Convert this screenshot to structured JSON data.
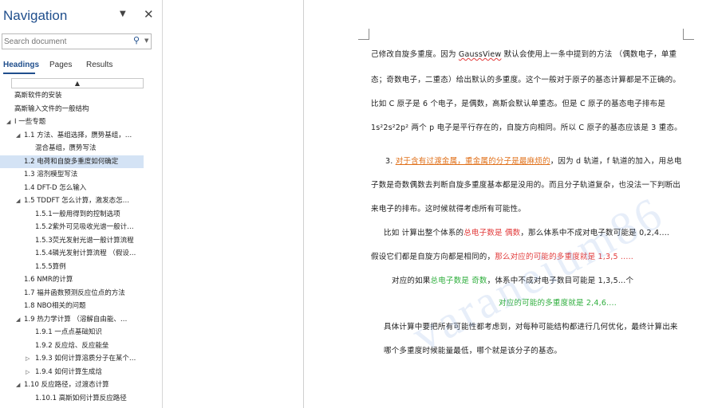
{
  "nav": {
    "title": "Navigation",
    "dropdown_icon": "▼",
    "close_icon": "✕",
    "search_placeholder": "Search document",
    "search_icon": "⚲",
    "search_caret": "▼",
    "tabs": [
      {
        "label": "Headings",
        "active": true
      },
      {
        "label": "Pages",
        "active": false
      },
      {
        "label": "Results",
        "active": false
      }
    ],
    "collapse_glyph": "▲",
    "tree": [
      {
        "label": "高斯软件的安装",
        "level": 0,
        "toggle": ""
      },
      {
        "label": "高斯输入文件的一般结构",
        "level": 0,
        "toggle": ""
      },
      {
        "label": "I 一些专题",
        "level": 0,
        "toggle": "◢"
      },
      {
        "label": "1.1 方法、基组选择，赝势基组，…",
        "level": 1,
        "toggle": "◢"
      },
      {
        "label": "混合基组，赝势写法",
        "level": 2,
        "toggle": ""
      },
      {
        "label": "1.2 电荷和自旋多重度如何确定",
        "level": 1,
        "toggle": "",
        "selected": true
      },
      {
        "label": "1.3 溶剂模型写法",
        "level": 1,
        "toggle": ""
      },
      {
        "label": "1.4 DFT-D 怎么输入",
        "level": 1,
        "toggle": ""
      },
      {
        "label": "1.5 TDDFT 怎么计算，激发态怎…",
        "level": 1,
        "toggle": "◢"
      },
      {
        "label": "1.5.1一般用得到的控制选项",
        "level": 2,
        "toggle": ""
      },
      {
        "label": "1.5.2紫外可见吸收光谱一般计…",
        "level": 2,
        "toggle": ""
      },
      {
        "label": "1.5.3荧光发射光谱一般计算流程",
        "level": 2,
        "toggle": ""
      },
      {
        "label": "1.5.4磷光发射计算流程 （假设…",
        "level": 2,
        "toggle": ""
      },
      {
        "label": "1.5.5算例",
        "level": 2,
        "toggle": ""
      },
      {
        "label": "1.6  NMR的计算",
        "level": 1,
        "toggle": ""
      },
      {
        "label": "1.7 福井函数预测反应位点的方法",
        "level": 1,
        "toggle": ""
      },
      {
        "label": "1.8 NBO相关的问题",
        "level": 1,
        "toggle": ""
      },
      {
        "label": "1.9 热力学计算 （溶解自由能、…",
        "level": 1,
        "toggle": "◢"
      },
      {
        "label": "1.9.1 一点点基础知识",
        "level": 2,
        "toggle": ""
      },
      {
        "label": "1.9.2 反应焓、反应能垒",
        "level": 2,
        "toggle": ""
      },
      {
        "label": "1.9.3 如何计算溶质分子在某个…",
        "level": 2,
        "toggle": "▷"
      },
      {
        "label": "1.9.4 如何计算生成焓",
        "level": 2,
        "toggle": "▷"
      },
      {
        "label": "1.10 反应路径，过渡态计算",
        "level": 1,
        "toggle": "◢"
      },
      {
        "label": "1.10.1 高斯如何计算反应路径",
        "level": 2,
        "toggle": ""
      }
    ]
  },
  "doc": {
    "lines": [
      {
        "segments": [
          {
            "t": "己修改自旋多重度。因为 ",
            "c": ""
          },
          {
            "t": "GaussView",
            "c": "underline-red"
          },
          {
            "t": " 默认会使用上一条中提到的方法  （偶数电子，单重",
            "c": ""
          }
        ]
      },
      {
        "segments": [
          {
            "t": "态；奇数电子，二重态）给出默认的多重度。这个一般对于原子的基态计算都是不正确的。",
            "c": ""
          }
        ]
      },
      {
        "segments": [
          {
            "t": "比如 C 原子是 6 个电子，是偶数，高斯会默认单重态。但是 C 原子的基态电子排布是",
            "c": ""
          }
        ]
      },
      {
        "segments": [
          {
            "t": "1s²2s²2p² 两个 p 电子是平行存在的，自旋方向相同。所以 C 原子的基态应该是 3 重态。",
            "c": ""
          }
        ]
      },
      {
        "segments": [
          {
            "t": "3. ",
            "c": ""
          },
          {
            "t": "对于含有过渡金属，重金属的分子是最麻烦的",
            "c": "orange"
          },
          {
            "t": "，因为 d 轨道，f 轨道的加入，用总电",
            "c": ""
          }
        ]
      },
      {
        "segments": [
          {
            "t": "子数是奇数偶数去判断自旋多重度基本都是没用的。而且分子轨道复杂，也没法一下判断出",
            "c": ""
          }
        ]
      },
      {
        "segments": [
          {
            "t": "来电子的排布。这时候就得考虑所有可能性。",
            "c": ""
          }
        ]
      },
      {
        "segments": [
          {
            "t": "比如 计算出整个体系的",
            "c": ""
          },
          {
            "t": "总电子数是 偶数",
            "c": "red"
          },
          {
            "t": "，那么体系中不成对电子数可能是 0,2,4....",
            "c": ""
          }
        ]
      },
      {
        "segments": [
          {
            "t": "假设它们都是自旋方向都是相同的，",
            "c": ""
          },
          {
            "t": "那么对应的可能的多重度就是 1,3,5 .....",
            "c": "red"
          }
        ]
      },
      {
        "segments": [
          {
            "t": "对应的如果",
            "c": ""
          },
          {
            "t": "总电子数是 奇数",
            "c": "green"
          },
          {
            "t": "，体系中不成对电子数目可能是 1,3,5...个",
            "c": ""
          }
        ]
      },
      {
        "segments": [
          {
            "t": "对应的可能的多重度就是 2,4,6....",
            "c": "green"
          }
        ]
      },
      {
        "segments": [
          {
            "t": "具体计算中要把所有可能性都考虑到，对每种可能结构都进行几何优化，最终计算出来",
            "c": ""
          }
        ]
      },
      {
        "segments": [
          {
            "t": "哪个多重度时候能量最低，哪个就是该分子的基态。",
            "c": ""
          }
        ]
      }
    ],
    "watermark": "varaneium86"
  }
}
